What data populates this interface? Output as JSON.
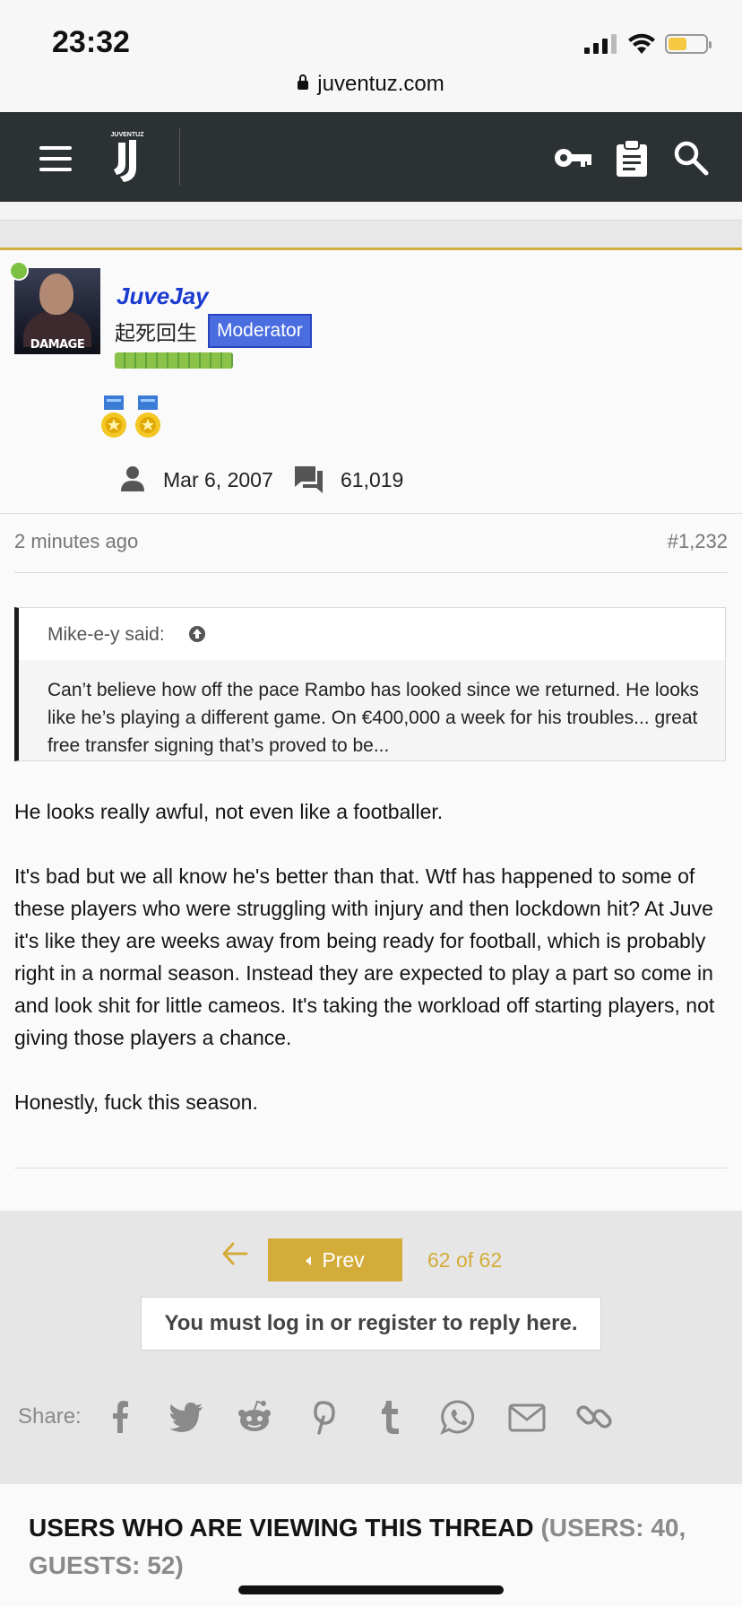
{
  "status_bar": {
    "time": "23:32",
    "url": "juventuz.com"
  },
  "navbar": {
    "logo_text": "JUVENTUZ",
    "icons": [
      "menu-icon",
      "key-icon",
      "clipboard-icon",
      "search-icon"
    ]
  },
  "post": {
    "author": {
      "username": "JuveJay",
      "user_title": "起死回生",
      "badge": "Moderator",
      "avatar_caption": "DAMAGE REPORT",
      "joined": "Mar 6, 2007",
      "message_count": "61,019",
      "online": true
    },
    "timestamp": "2 minutes ago",
    "post_number": "#1,232",
    "quote": {
      "attribution": "Mike-e-y said:",
      "text": "Can’t believe how off the pace Rambo has looked since we returned. He looks like he’s playing a different game. On €400,000 a week for his troubles... great free transfer signing that’s proved to be..."
    },
    "paragraphs": [
      "He looks really awful, not even like a footballer.",
      "It's bad but we all know he's better than that. Wtf has happened to some of these players who were struggling with injury and then lockdown hit? At Juve it's like they are weeks away from being ready for football, which is probably right in a normal season. Instead they are expected to play a part so come in and look shit for little cameos. It's taking the workload off starting players, not giving those players a chance.",
      "Honestly, fuck this season."
    ]
  },
  "pagination": {
    "prev_label": "Prev",
    "page_info": "62 of 62",
    "login_prompt": "You must log in or register to reply here."
  },
  "share": {
    "label": "Share:",
    "icons": [
      "facebook-icon",
      "twitter-icon",
      "reddit-icon",
      "pinterest-icon",
      "tumblr-icon",
      "whatsapp-icon",
      "email-icon",
      "link-icon"
    ]
  },
  "viewers": {
    "title": "USERS WHO ARE VIEWING THIS THREAD",
    "counts": "(USERS: 40, GUESTS: 52)"
  },
  "colors": {
    "accent": "#d4ac3a",
    "navbar": "#2c3133",
    "username": "#1a3bd0",
    "moderator_badge": "#4a6de0",
    "online": "#7cc142"
  }
}
